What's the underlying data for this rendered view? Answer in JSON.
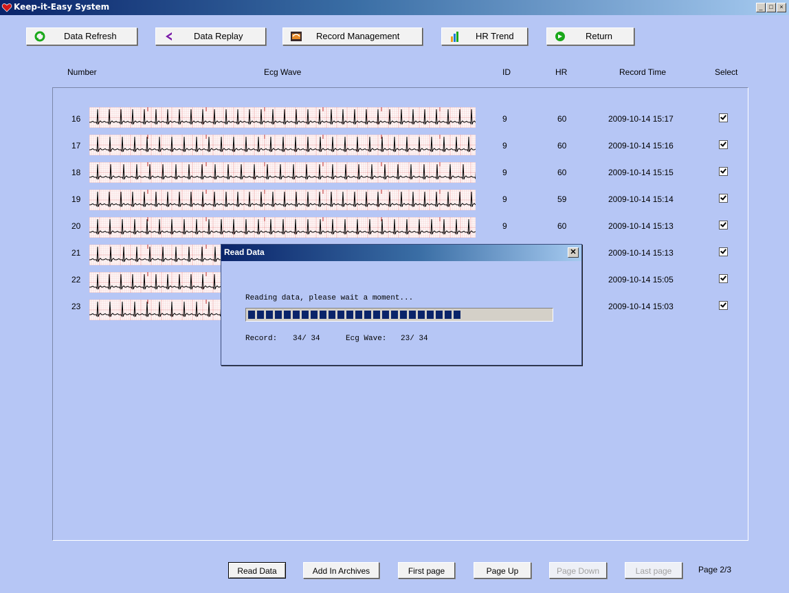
{
  "window": {
    "title": "Keep-it-Easy System",
    "controls": [
      "_",
      "□",
      "×"
    ]
  },
  "toolbar": {
    "buttons": [
      {
        "label": "Data Refresh",
        "icon": "refresh-icon"
      },
      {
        "label": "Data Replay",
        "icon": "arrow-left-icon"
      },
      {
        "label": "Record Management",
        "icon": "records-icon"
      },
      {
        "label": "HR Trend",
        "icon": "bar-chart-icon"
      },
      {
        "label": "Return",
        "icon": "return-icon"
      }
    ]
  },
  "table": {
    "headers": {
      "number": "Number",
      "wave": "Ecg Wave",
      "id": "ID",
      "hr": "HR",
      "time": "Record Time",
      "select": "Select"
    },
    "rows": [
      {
        "number": "16",
        "id": "9",
        "hr": "60",
        "time": "2009-10-14  15:17",
        "selected": true
      },
      {
        "number": "17",
        "id": "9",
        "hr": "60",
        "time": "2009-10-14  15:16",
        "selected": true
      },
      {
        "number": "18",
        "id": "9",
        "hr": "60",
        "time": "2009-10-14  15:15",
        "selected": true
      },
      {
        "number": "19",
        "id": "9",
        "hr": "59",
        "time": "2009-10-14  15:14",
        "selected": true
      },
      {
        "number": "20",
        "id": "9",
        "hr": "60",
        "time": "2009-10-14  15:13",
        "selected": true
      },
      {
        "number": "21",
        "id": "",
        "hr": "",
        "time": "2009-10-14  15:13",
        "selected": true
      },
      {
        "number": "22",
        "id": "",
        "hr": "",
        "time": "2009-10-14  15:05",
        "selected": true
      },
      {
        "number": "23",
        "id": "",
        "hr": "",
        "time": "2009-10-14  15:03",
        "selected": true
      }
    ]
  },
  "dialog": {
    "title": "Read Data",
    "message": "Reading data, please wait a moment...",
    "progress": 0.7,
    "record_label": "Record:",
    "record_value": "34/ 34",
    "wave_label": "Ecg Wave:",
    "wave_value": "23/ 34"
  },
  "bottom": {
    "read_data": "Read Data",
    "add_archives": "Add In Archives",
    "first_page": "First page",
    "page_up": "Page Up",
    "page_down": "Page Down",
    "last_page": "Last page",
    "page_info": "Page 2/3"
  },
  "colors": {
    "background": "#b6c6f5",
    "title_bar": "#0a246a",
    "ecg_grid": "#f4b0b0",
    "progress": "#0a246a"
  }
}
